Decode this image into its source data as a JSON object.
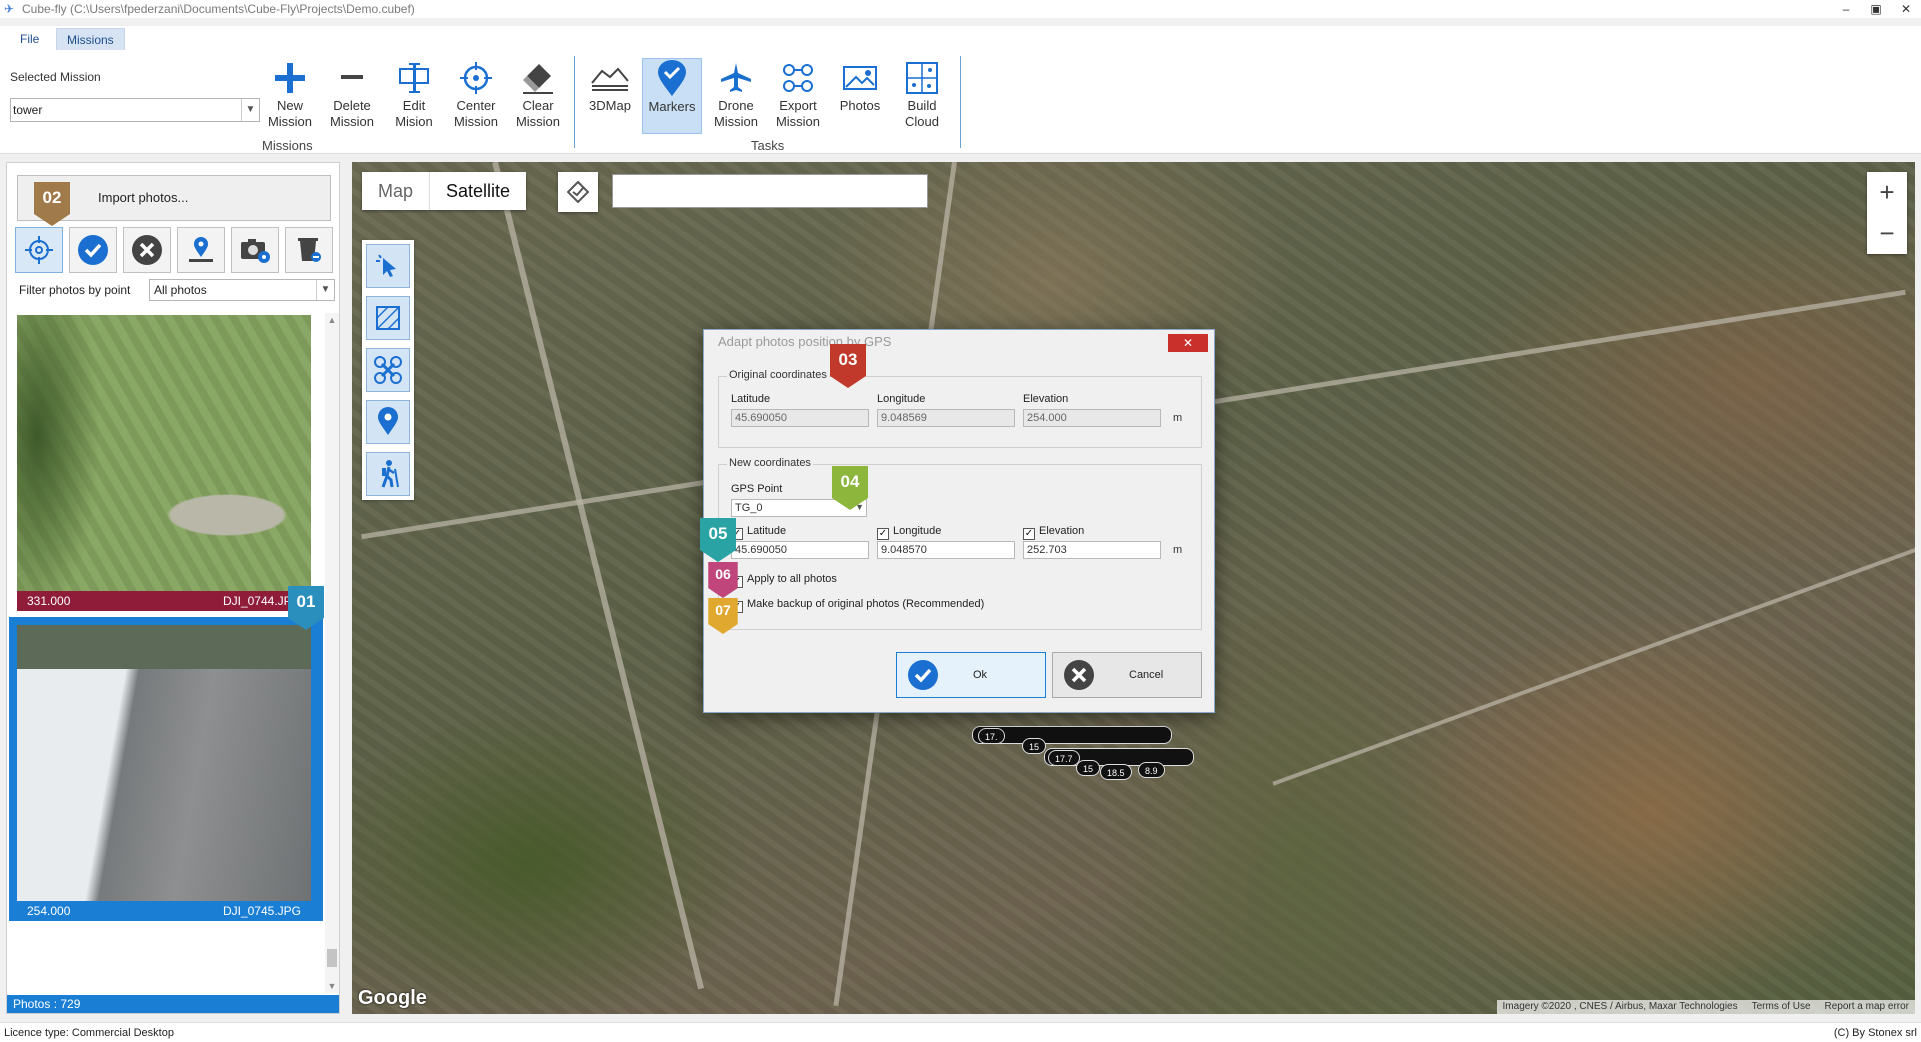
{
  "window": {
    "title": "Cube-fly (C:\\Users\\fpederzani\\Documents\\Cube-Fly\\Projects\\Demo.cubef)",
    "controls": [
      "–",
      "▣",
      "✕"
    ]
  },
  "menu": {
    "tabs": [
      {
        "label": "File",
        "active": false
      },
      {
        "label": "Missions",
        "active": true
      }
    ]
  },
  "ribbon": {
    "selected_mission_label": "Selected Mission",
    "selected_mission_value": "tower",
    "missions_group": "Missions",
    "tasks_group": "Tasks",
    "buttons": [
      {
        "label": "New\nMission",
        "icon": "plus-icon"
      },
      {
        "label": "Delete\nMission",
        "icon": "minus-icon"
      },
      {
        "label": "Edit\nMision",
        "icon": "edit-icon"
      },
      {
        "label": "Center\nMission",
        "icon": "crosshair-icon"
      },
      {
        "label": "Clear\nMission",
        "icon": "eraser-icon"
      },
      {
        "label": "3DMap",
        "icon": "terrain-icon"
      },
      {
        "label": "Markers",
        "icon": "marker-check-icon",
        "active": true
      },
      {
        "label": "Drone\nMission",
        "icon": "plane-icon"
      },
      {
        "label": "Export\nMission",
        "icon": "export-icon"
      },
      {
        "label": "Photos",
        "icon": "photos-icon"
      },
      {
        "label": "Build\nCloud",
        "icon": "cloud-build-icon"
      }
    ]
  },
  "left_panel": {
    "import_label": "Import photos...",
    "filter_label": "Filter photos by point",
    "filter_value": "All photos",
    "photos": [
      {
        "elevation": "331.000",
        "filename": "DJI_0744.JPG"
      },
      {
        "elevation": "254.000",
        "filename": "DJI_0745.JPG",
        "selected": true
      }
    ],
    "photo_count": "Photos : 729"
  },
  "map": {
    "type_map": "Map",
    "type_satellite": "Satellite",
    "zoom_in": "+",
    "zoom_out": "−",
    "google": "Google",
    "attribution": [
      "Imagery ©2020 , CNES / Airbus, Maxar Technologies",
      "Terms of Use",
      "Report a map error"
    ],
    "markers": [
      "17.",
      "15",
      "17.7",
      "15",
      "18.5",
      "8.9"
    ]
  },
  "dialog": {
    "title": "Adapt photos position by GPS",
    "close": "✕",
    "original_title": "Original coordinates",
    "labels": {
      "latitude": "Latitude",
      "longitude": "Longitude",
      "elevation": "Elevation",
      "unit": "m"
    },
    "original": {
      "latitude": "45.690050",
      "longitude": "9.048569",
      "elevation": "254.000"
    },
    "new_title": "New coordinates",
    "gps_point_label": "GPS Point",
    "gps_point_value": "TG_0",
    "new": {
      "latitude": "45.690050",
      "longitude": "9.048570",
      "elevation": "252.703"
    },
    "apply_all": "Apply to all photos",
    "backup": "Make backup of original photos (Recommended)",
    "ok": "Ok",
    "cancel": "Cancel"
  },
  "badges": [
    {
      "text": "01",
      "color": "#2a8fbd"
    },
    {
      "text": "02",
      "color": "#a07a4a"
    },
    {
      "text": "03",
      "color": "#c0392b"
    },
    {
      "text": "04",
      "color": "#8cb63c"
    },
    {
      "text": "05",
      "color": "#29a3a3"
    },
    {
      "text": "06",
      "color": "#c0457a"
    },
    {
      "text": "07",
      "color": "#e0a82e"
    }
  ],
  "status": {
    "licence": "Licence type: Commercial Desktop",
    "copyright": "(C) By Stonex srl"
  }
}
